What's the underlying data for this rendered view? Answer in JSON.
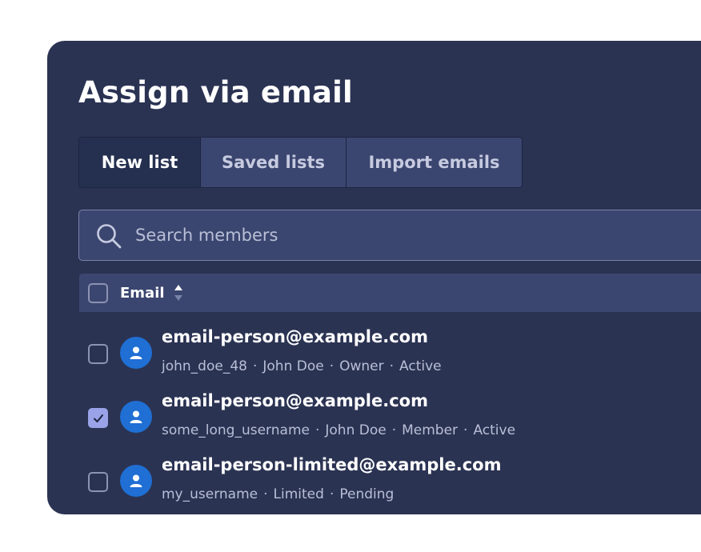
{
  "dialog": {
    "title": "Assign via email"
  },
  "tabs": [
    {
      "label": "New list",
      "active": true
    },
    {
      "label": "Saved lists",
      "active": false
    },
    {
      "label": "Import emails",
      "active": false
    }
  ],
  "search": {
    "placeholder": "Search members",
    "value": ""
  },
  "table": {
    "column_email": "Email",
    "select_all_checked": false,
    "rows": [
      {
        "email": "email-person@example.com",
        "meta": [
          "john_doe_48",
          "John Doe",
          "Owner",
          "Active"
        ],
        "checked": false
      },
      {
        "email": "email-person@example.com",
        "meta": [
          "some_long_username",
          "John Doe",
          "Member",
          "Active"
        ],
        "checked": true
      },
      {
        "email": "email-person-limited@example.com",
        "meta": [
          "my_username",
          "Limited",
          "Pending"
        ],
        "checked": false
      }
    ]
  },
  "icons": {
    "search": "search-icon",
    "sort": "sort-icon",
    "avatar": "user-icon",
    "check": "check-icon"
  },
  "colors": {
    "panel_bg": "#2b3353",
    "tab_active_bg": "#253050",
    "tab_bg": "#3b4670",
    "avatar_bg": "#1f6fd4",
    "checkbox_checked": "#9aa2e8"
  }
}
